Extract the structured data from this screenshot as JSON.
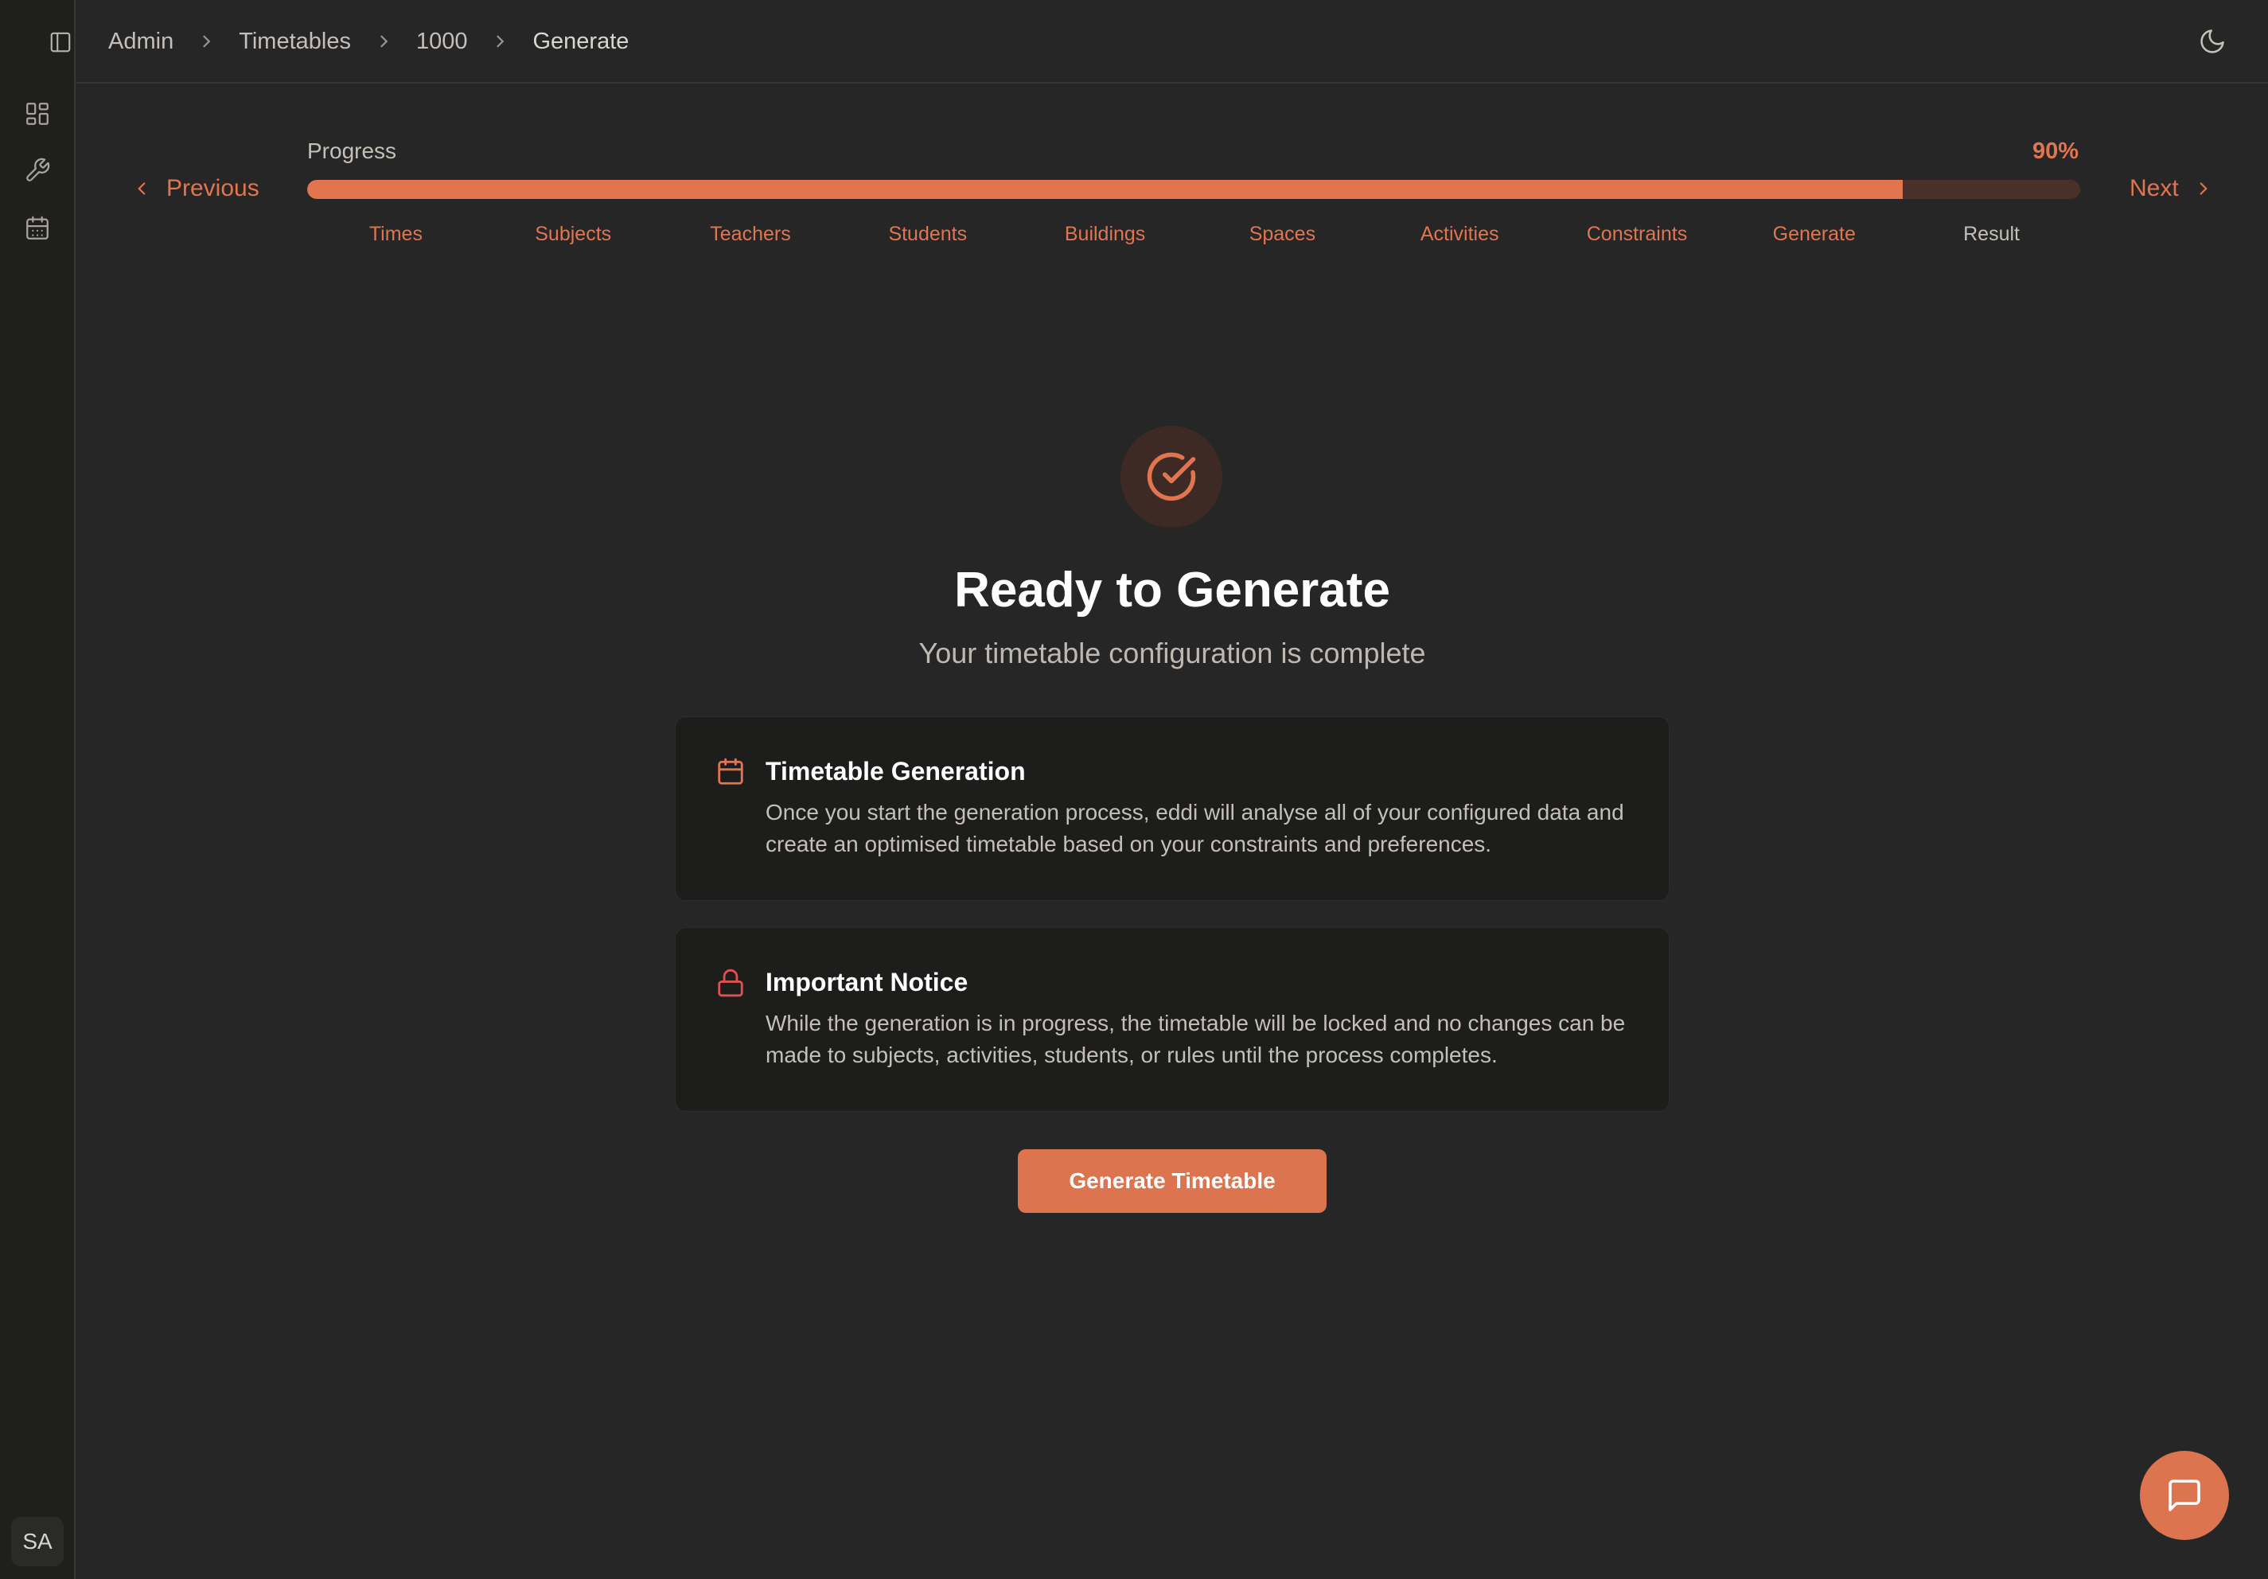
{
  "breadcrumb": {
    "items": [
      "Admin",
      "Timetables",
      "1000",
      "Generate"
    ]
  },
  "progress": {
    "label": "Progress",
    "percent_text": "90%",
    "value": 0.9,
    "prev_label": "Previous",
    "next_label": "Next",
    "steps": [
      "Times",
      "Subjects",
      "Teachers",
      "Students",
      "Buildings",
      "Spaces",
      "Activities",
      "Constraints",
      "Generate",
      "Result"
    ]
  },
  "hero": {
    "title": "Ready to Generate",
    "subtitle": "Your timetable configuration is complete"
  },
  "cards": [
    {
      "title": "Timetable Generation",
      "body": "Once you start the generation process, eddi will analyse all of your configured data and create an optimised timetable based on your constraints and preferences.",
      "icon": "calendar-icon"
    },
    {
      "title": "Important Notice",
      "body": "While the generation is in progress, the timetable will be locked and no changes can be made to subjects, activities, students, or rules until the process completes.",
      "icon": "lock-icon"
    }
  ],
  "actions": {
    "generate_label": "Generate Timetable"
  },
  "user": {
    "initials": "SA"
  },
  "colors": {
    "accent": "#e0754f",
    "danger": "#e05050",
    "background": "#262626"
  }
}
